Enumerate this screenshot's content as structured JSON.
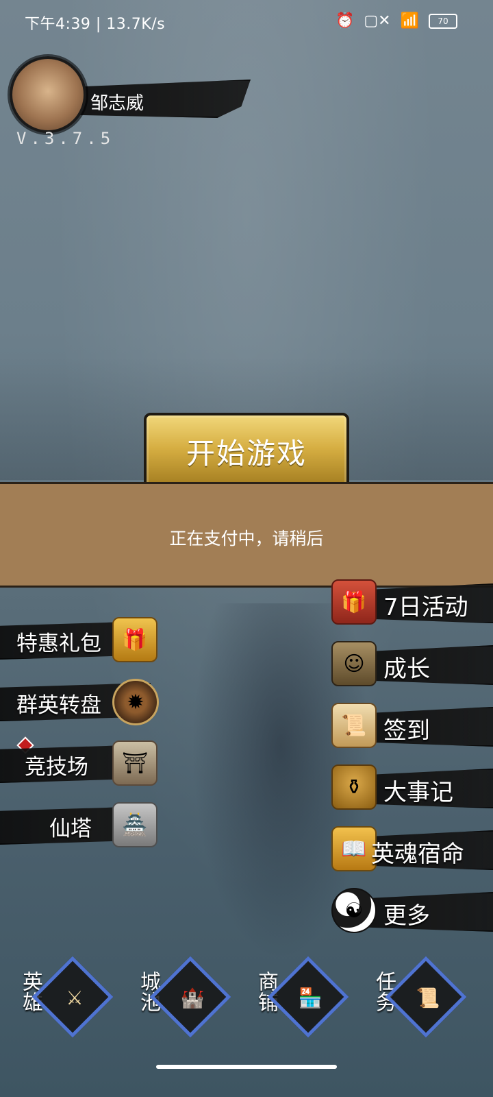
{
  "status_bar": {
    "time_speed": "下午4:39 | 13.7K/s",
    "alarm_icon": "alarm-icon",
    "sim_icon": "sim-x-icon",
    "wifi_icon": "wifi-icon",
    "battery": "70"
  },
  "profile": {
    "name": "邹志威",
    "version": "V.3.7.5"
  },
  "main": {
    "start_button": "开始游戏"
  },
  "toast": {
    "text": "正在支付中，请稍后"
  },
  "left_menu": {
    "items": [
      {
        "label": "特惠礼包",
        "icon": "gift-box-icon"
      },
      {
        "label": "群英转盘",
        "icon": "wheel-icon"
      },
      {
        "label": "竞技场",
        "icon": "arena-icon"
      },
      {
        "label": "仙塔",
        "icon": "pagoda-icon"
      }
    ]
  },
  "right_menu": {
    "items": [
      {
        "label": "7日活动",
        "icon": "red-gift-icon"
      },
      {
        "label": "成长",
        "icon": "hero-icon"
      },
      {
        "label": "签到",
        "icon": "scroll-icon"
      },
      {
        "label": "大事记",
        "icon": "urn-icon"
      },
      {
        "label": "英魂宿命",
        "icon": "book-icon"
      },
      {
        "label": "更多",
        "icon": "yin-yang-icon"
      }
    ]
  },
  "bottom_nav": {
    "items": [
      {
        "label": "英雄",
        "icon": "hero-portrait-icon"
      },
      {
        "label": "城池",
        "icon": "castle-icon"
      },
      {
        "label": "商铺",
        "icon": "shop-icon"
      },
      {
        "label": "任务",
        "icon": "task-scroll-icon"
      }
    ]
  }
}
